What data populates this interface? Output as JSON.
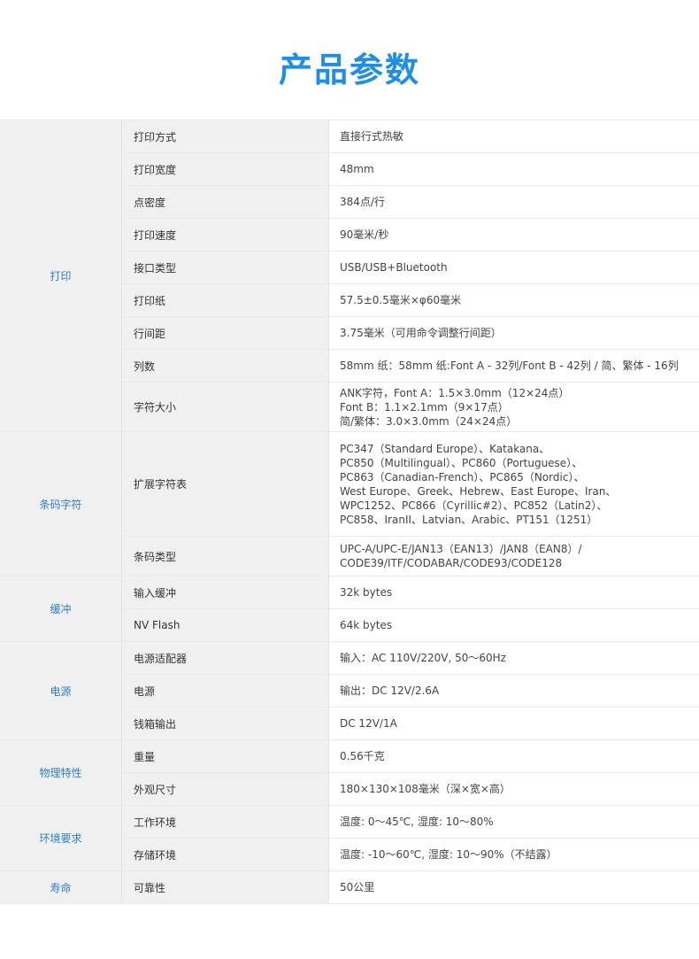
{
  "page_title": "产品参数",
  "groups": [
    {
      "name": "打印",
      "rows": [
        {
          "key": "打印方式",
          "value": [
            "直接行式热敏"
          ]
        },
        {
          "key": "打印宽度",
          "value": [
            "48mm"
          ]
        },
        {
          "key": "点密度",
          "value": [
            "384点/行"
          ]
        },
        {
          "key": "打印速度",
          "value": [
            "90毫米/秒"
          ]
        },
        {
          "key": "接口类型",
          "value": [
            "USB/USB+Bluetooth"
          ]
        },
        {
          "key": "打印纸",
          "value": [
            "57.5±0.5毫米×φ60毫米"
          ]
        },
        {
          "key": "行间距",
          "value": [
            "3.75毫米（可用命令调整行间距）"
          ]
        },
        {
          "key": "列数",
          "value": [
            "58mm 纸：58mm 纸:Font A - 32列/Font B - 42列 / 简、繁体 - 16列"
          ]
        },
        {
          "key": "字符大小",
          "value": [
            "ANK字符，Font A：1.5×3.0mm（12×24点）",
            "Font B：1.1×2.1mm（9×17点）",
            "简/繁体：3.0×3.0mm（24×24点）"
          ]
        }
      ]
    },
    {
      "name": "条码字符",
      "rows": [
        {
          "key": "扩展字符表",
          "value": [
            "PC347（Standard Europe）、Katakana、",
            "PC850（Multilingual）、PC860（Portuguese）、",
            "PC863（Canadian-French）、PC865（Nordic）、",
            "West Europe、Greek、Hebrew、East Europe、Iran、",
            "WPC1252、PC866（Cyrillic#2）、PC852（Latin2）、",
            "PC858、IranII、Latvian、Arabic、PT151（1251）"
          ]
        },
        {
          "key": "条码类型",
          "value": [
            "UPC-A/UPC-E/JAN13（EAN13）/JAN8（EAN8）/",
            "CODE39/ITF/CODABAR/CODE93/CODE128"
          ]
        }
      ]
    },
    {
      "name": "缓冲",
      "rows": [
        {
          "key": "输入缓冲",
          "value": [
            "32k bytes"
          ]
        },
        {
          "key": "NV Flash",
          "value": [
            "64k bytes"
          ]
        }
      ]
    },
    {
      "name": "电源",
      "rows": [
        {
          "key": "电源适配器",
          "value": [
            "输入：AC 110V/220V, 50～60Hz"
          ]
        },
        {
          "key": "电源",
          "value": [
            "输出：DC 12V/2.6A"
          ]
        },
        {
          "key": "钱箱输出",
          "value": [
            "DC 12V/1A"
          ]
        }
      ]
    },
    {
      "name": "物理特性",
      "rows": [
        {
          "key": "重量",
          "value": [
            "0.56千克"
          ]
        },
        {
          "key": "外观尺寸",
          "value": [
            "180×130×108毫米（深×宽×高）"
          ]
        }
      ]
    },
    {
      "name": "环境要求",
      "rows": [
        {
          "key": "工作环境",
          "value": [
            "温度: 0～45℃, 湿度: 10～80%"
          ]
        },
        {
          "key": "存储环境",
          "value": [
            "温度: -10～60℃, 湿度: 10～90%（不结露）"
          ]
        }
      ]
    },
    {
      "name": "寿命",
      "rows": [
        {
          "key": "可靠性",
          "value": [
            "50公里"
          ]
        }
      ]
    }
  ]
}
